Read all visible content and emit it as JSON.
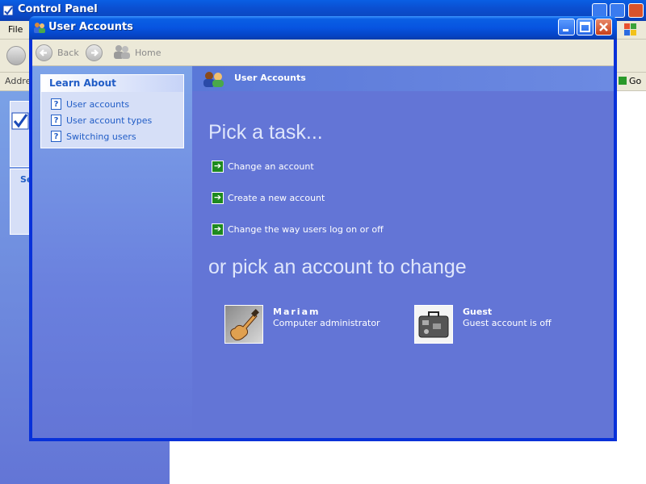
{
  "background_window": {
    "title": "Control Panel",
    "menu_file": "File",
    "address_label": "Addre",
    "go_label": "Go",
    "left_fragment": "Se"
  },
  "window": {
    "title": "User Accounts"
  },
  "nav": {
    "back": "Back",
    "home": "Home"
  },
  "learn_about": {
    "title": "Learn About",
    "items": [
      {
        "label": "User accounts",
        "icon": "help-icon"
      },
      {
        "label": "User account types",
        "icon": "help-icon"
      },
      {
        "label": "Switching users",
        "icon": "help-icon"
      }
    ]
  },
  "main": {
    "banner_title": "User Accounts",
    "pick_task": "Pick a task...",
    "tasks": [
      {
        "label": "Change an account",
        "icon": "green-arrow-icon"
      },
      {
        "label": "Create a new account",
        "icon": "green-arrow-icon"
      },
      {
        "label": "Change the way users log on or off",
        "icon": "green-arrow-icon"
      }
    ],
    "pick_account": "or pick an account to change",
    "accounts": [
      {
        "name": "Mariam",
        "description": "Computer administrator",
        "picture": "guitar-picture"
      },
      {
        "name": "Guest",
        "description": "Guest account is off",
        "picture": "suitcase-picture"
      }
    ]
  },
  "colors": {
    "accent_blue": "#215dc6",
    "main_pane": "#6375d6",
    "titlebar": "#0754e0",
    "task_icon_green": "#1e8a1e"
  }
}
